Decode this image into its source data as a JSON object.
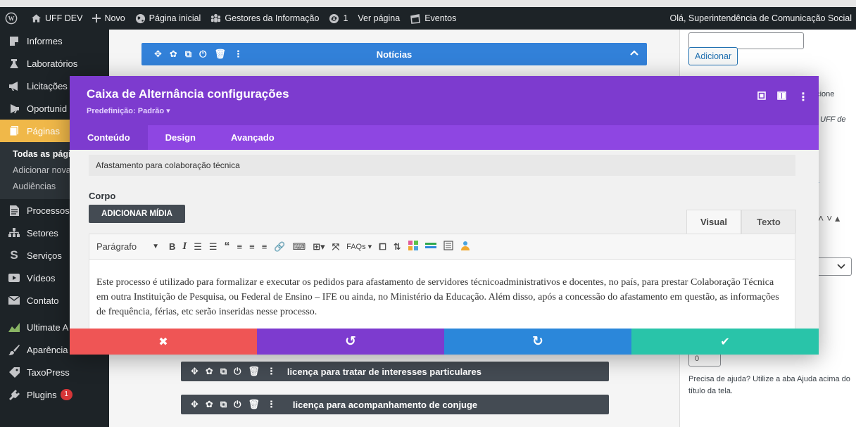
{
  "admin_bar": {
    "site_name": "UFF DEV",
    "new_label": "Novo",
    "home_label": "Página inicial",
    "gestores_label": "Gestores da Informação",
    "updates_count": "1",
    "view_page_label": "Ver página",
    "events_label": "Eventos",
    "greeting": "Olá, Superintendência de Comunicação Social"
  },
  "sidebar": {
    "items": [
      {
        "label": "Informes"
      },
      {
        "label": "Laboratórios"
      },
      {
        "label": "Licitações"
      },
      {
        "label": "Oportunid"
      },
      {
        "label": "Páginas"
      }
    ],
    "submenu": [
      "Todas as págin",
      "Adicionar nova",
      "Audiências"
    ],
    "items2": [
      {
        "label": "Processos"
      },
      {
        "label": "Setores"
      },
      {
        "label": "Serviços"
      },
      {
        "label": "Vídeos"
      },
      {
        "label": "Contato"
      },
      {
        "label": "Ultimate A"
      },
      {
        "label": "Aparência"
      },
      {
        "label": "TaxoPress"
      },
      {
        "label": "Plugins",
        "badge": "1"
      }
    ]
  },
  "builder": {
    "module_title": "Notícias",
    "row1_label": "licença para tratar de interesses particulares",
    "row2_label": "licença para acompanhamento de conjuge"
  },
  "right_panel": {
    "add_button": "Adicionar",
    "partial1": "ecione",
    "partial2": "UFF de",
    "partial_link": "s",
    "help_text": "Precisa de ajuda? Utilize a aba Ajuda acima do título da tela.",
    "number_value": "0"
  },
  "modal": {
    "title": "Caixa de Alternância configurações",
    "preset": "Predefinição: Padrão ▾",
    "tabs": [
      "Conteúdo",
      "Design",
      "Avançado"
    ],
    "field_value": "Afastamento para colaboração técnica",
    "body_label": "Corpo",
    "add_media": "ADICIONAR MÍDIA",
    "editor_tabs": [
      "Visual",
      "Texto"
    ],
    "format_select": "Parágrafo",
    "faqs_label": "FAQs",
    "body_text": "Este processo é utilizado para formalizar e executar os pedidos para afastamento de servidores técnicoadministrativos e docentes, no país, para prestar Colaboração Técnica em outra Instituição de Pesquisa, ou Federal de Ensino – IFE ou ainda, no Ministério da Educação. Além disso, após a concessão do afastamento em questão, as informações de frequência, férias, etc serão inseridas nesse processo."
  },
  "colors": {
    "modal_header": "#7d3bcf",
    "tabs_bar": "#8e46e2",
    "cancel": "#ef5555",
    "undo": "#7d3bcf",
    "redo": "#2b87da",
    "save": "#29c4a9",
    "blue_module": "#3281d9"
  }
}
